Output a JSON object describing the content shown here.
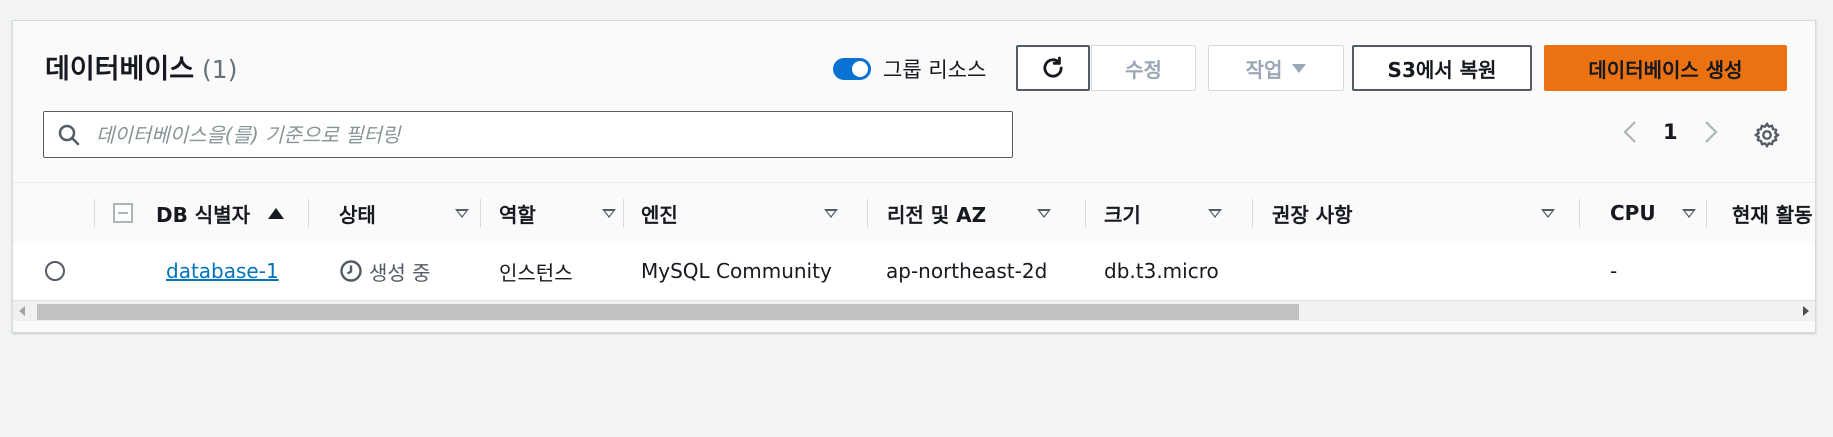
{
  "header": {
    "title": "데이터베이스",
    "count": "(1)",
    "group_toggle_label": "그룹 리소스",
    "group_toggle_on": true
  },
  "toolbar": {
    "refresh_icon": "refresh-icon",
    "edit_label": "수정",
    "actions_label": "작업",
    "restore_s3_label": "S3에서 복원",
    "create_label": "데이터베이스 생성"
  },
  "search": {
    "placeholder": "데이터베이스을(를) 기준으로 필터링",
    "value": ""
  },
  "pagination": {
    "current_page": "1"
  },
  "colors": {
    "primary": "#ec7211",
    "toggle": "#0972d3",
    "link": "#0073bb"
  },
  "table": {
    "columns": [
      {
        "label": "DB 식별자"
      },
      {
        "label": "상태"
      },
      {
        "label": "역할"
      },
      {
        "label": "엔진"
      },
      {
        "label": "리전 및 AZ"
      },
      {
        "label": "크기"
      },
      {
        "label": "권장 사항"
      },
      {
        "label": "CPU"
      },
      {
        "label": "현재 활동"
      }
    ],
    "rows": [
      {
        "identifier": "database-1",
        "status": "생성 중",
        "role": "인스턴스",
        "engine": "MySQL Community",
        "region_az": "ap-northeast-2d",
        "size": "db.t3.micro",
        "recommendations": "",
        "cpu": "-"
      }
    ]
  }
}
